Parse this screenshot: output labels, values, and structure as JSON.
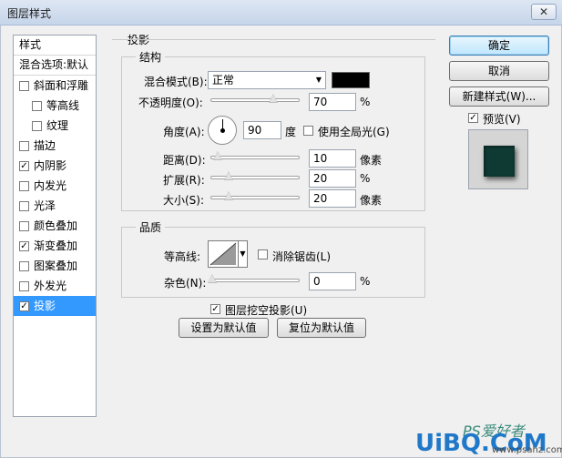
{
  "window": {
    "title": "图层样式",
    "close": "✕"
  },
  "left_panel": {
    "header": "样式",
    "blend_options": "混合选项:默认",
    "items": [
      {
        "label": "斜面和浮雕",
        "checked": false,
        "sub": false,
        "active": false
      },
      {
        "label": "等高线",
        "checked": false,
        "sub": true,
        "active": false
      },
      {
        "label": "纹理",
        "checked": false,
        "sub": true,
        "active": false
      },
      {
        "label": "描边",
        "checked": false,
        "sub": false,
        "active": false
      },
      {
        "label": "内阴影",
        "checked": true,
        "sub": false,
        "active": false
      },
      {
        "label": "内发光",
        "checked": false,
        "sub": false,
        "active": false
      },
      {
        "label": "光泽",
        "checked": false,
        "sub": false,
        "active": false
      },
      {
        "label": "颜色叠加",
        "checked": false,
        "sub": false,
        "active": false
      },
      {
        "label": "渐变叠加",
        "checked": true,
        "sub": false,
        "active": false
      },
      {
        "label": "图案叠加",
        "checked": false,
        "sub": false,
        "active": false
      },
      {
        "label": "外发光",
        "checked": false,
        "sub": false,
        "active": false
      },
      {
        "label": "投影",
        "checked": true,
        "sub": false,
        "active": true
      }
    ]
  },
  "drop_shadow": {
    "title": "投影",
    "structure": {
      "title": "结构",
      "blend_mode_label": "混合模式(B):",
      "blend_mode_value": "正常",
      "color": "#000000",
      "opacity_label": "不透明度(O):",
      "opacity_value": "70",
      "opacity_unit": "%",
      "angle_label": "角度(A):",
      "angle_value": "90",
      "angle_unit": "度",
      "global_light_label": "使用全局光(G)",
      "global_light_checked": false,
      "distance_label": "距离(D):",
      "distance_value": "10",
      "distance_unit": "像素",
      "spread_label": "扩展(R):",
      "spread_value": "20",
      "spread_unit": "%",
      "size_label": "大小(S):",
      "size_value": "20",
      "size_unit": "像素"
    },
    "quality": {
      "title": "品质",
      "contour_label": "等高线:",
      "anti_alias_label": "消除锯齿(L)",
      "anti_alias_checked": false,
      "noise_label": "杂色(N):",
      "noise_value": "0",
      "noise_unit": "%"
    },
    "knockout_label": "图层挖空投影(U)",
    "knockout_checked": true,
    "set_default": "设置为默认值",
    "reset_default": "复位为默认值"
  },
  "right_panel": {
    "ok": "确定",
    "cancel": "取消",
    "new_style": "新建样式(W)...",
    "preview_label": "预览(V)",
    "preview_checked": true
  },
  "watermark": {
    "top": "PS爱好者",
    "main": "UiBQ.CoM",
    "small": "www.psahz.com"
  }
}
